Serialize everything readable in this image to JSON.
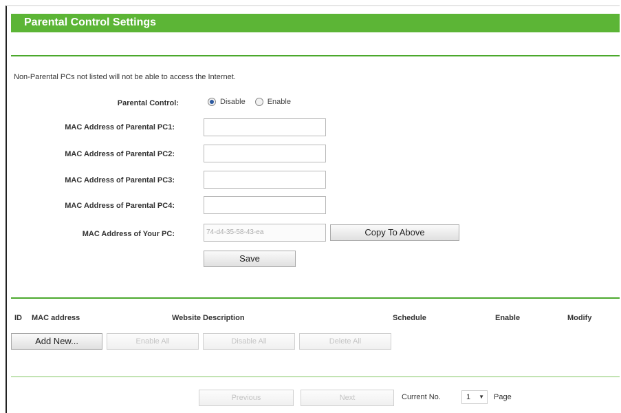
{
  "header": {
    "title": "Parental Control Settings"
  },
  "notice": "Non-Parental PCs not listed will not be able to access the Internet.",
  "parental_control": {
    "label": "Parental Control:",
    "options": [
      "Disable",
      "Enable"
    ],
    "selected": "Disable"
  },
  "mac_fields": [
    {
      "label": "MAC Address of Parental PC1:",
      "value": ""
    },
    {
      "label": "MAC Address of Parental PC2:",
      "value": ""
    },
    {
      "label": "MAC Address of Parental PC3:",
      "value": ""
    },
    {
      "label": "MAC Address of Parental PC4:",
      "value": ""
    }
  ],
  "your_pc": {
    "label": "MAC Address of Your PC:",
    "value": "74-d4-35-58-43-ea"
  },
  "buttons": {
    "copy_to_above": "Copy To Above",
    "save": "Save",
    "add_new": "Add New...",
    "enable_all": "Enable All",
    "disable_all": "Disable All",
    "delete_all": "Delete All",
    "previous": "Previous",
    "next": "Next"
  },
  "table": {
    "columns": [
      "ID",
      "MAC address",
      "Website Description",
      "Schedule",
      "Enable",
      "Modify"
    ]
  },
  "pager": {
    "current_label": "Current No.",
    "current_value": "1",
    "page_label": "Page"
  },
  "colors": {
    "header_green": "#5cb536",
    "divider_green": "#4ba82c",
    "selected_radio": "#2d5aa0"
  }
}
